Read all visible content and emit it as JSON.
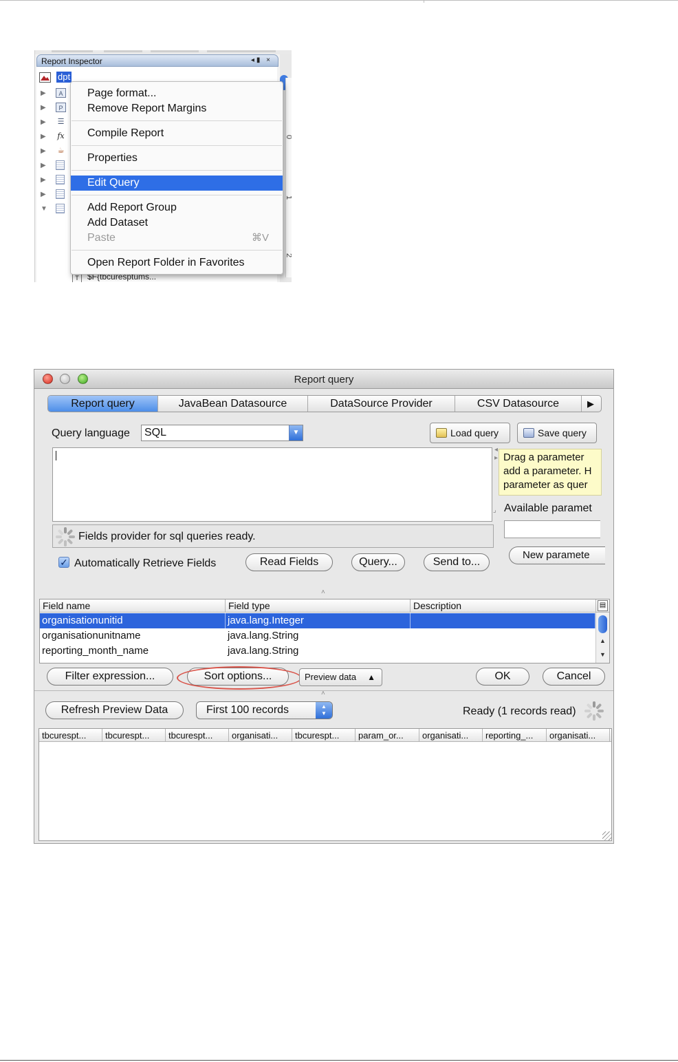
{
  "inspector": {
    "title": "Report Inspector",
    "selected_node": "dpt",
    "bottom_row_text": "$F{tbcuresptums...",
    "ruler_marks": [
      "0",
      "1",
      "2"
    ],
    "menu": {
      "page_format": "Page format...",
      "remove_margins": "Remove Report Margins",
      "compile": "Compile Report",
      "properties": "Properties",
      "edit_query": "Edit Query",
      "add_group": "Add Report Group",
      "add_dataset": "Add Dataset",
      "paste": "Paste",
      "paste_shortcut": "⌘V",
      "open_folder": "Open Report Folder in Favorites"
    }
  },
  "dialog": {
    "title": "Report query",
    "tabs": [
      "Report query",
      "JavaBean Datasource",
      "DataSource Provider",
      "CSV Datasource"
    ],
    "active_tab": "Report query",
    "query_language_label": "Query language",
    "query_language_value": "SQL",
    "load_query": "Load query",
    "save_query": "Save query",
    "query_text": "",
    "tooltip_lines": [
      "Drag a parameter",
      "add a parameter. H",
      "parameter as quer"
    ],
    "available_params_label": "Available paramet",
    "new_param_button": "New paramete",
    "provider_status": "Fields provider for sql queries ready.",
    "auto_retrieve_label": "Automatically Retrieve Fields",
    "auto_retrieve_checked": true,
    "read_fields": "Read Fields",
    "query_button": "Query...",
    "send_to": "Send to...",
    "fields_table": {
      "headers": [
        "Field name",
        "Field type",
        "Description"
      ],
      "rows": [
        {
          "name": "organisationunitid",
          "type": "java.lang.Integer",
          "description": ""
        },
        {
          "name": "organisationunitname",
          "type": "java.lang.String",
          "description": ""
        },
        {
          "name": "reporting_month_name",
          "type": "java.lang.String",
          "description": ""
        }
      ],
      "selected_row": 0
    },
    "filter_expression": "Filter expression...",
    "sort_options": "Sort options...",
    "preview_data": "Preview data",
    "ok": "OK",
    "cancel": "Cancel",
    "refresh_preview": "Refresh Preview Data",
    "records_limit": "First 100 records",
    "ready_status": "Ready (1 records read)",
    "preview_columns": [
      "tbcurespt...",
      "tbcurespt...",
      "tbcurespt...",
      "organisati...",
      "tbcurespt...",
      "param_or...",
      "organisati...",
      "reporting_...",
      "organisati..."
    ]
  },
  "colors": {
    "selection_blue": "#2c64dc",
    "highlight_oval": "#d9544a",
    "tooltip_bg": "#fdfbc9"
  }
}
